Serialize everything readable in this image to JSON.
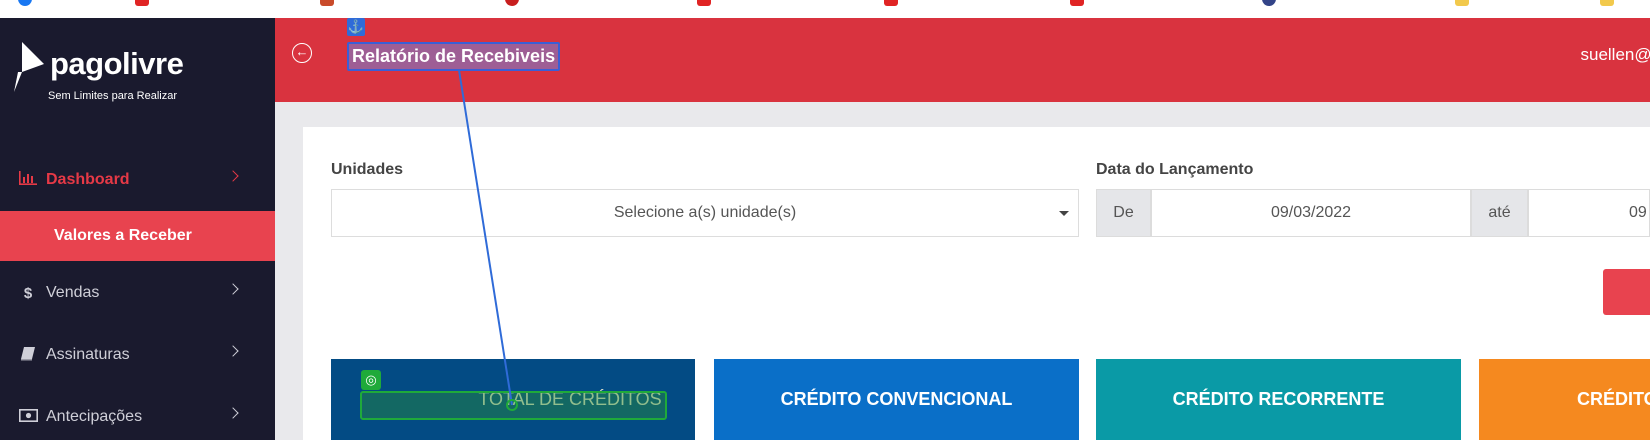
{
  "brand": {
    "name": "pagolivre",
    "tagline": "Sem Limites para Realizar"
  },
  "sidebar": {
    "items": [
      {
        "label": "Dashboard",
        "icon": "bar-chart-icon",
        "active": true
      },
      {
        "label": "Vendas",
        "icon": "dollar-icon",
        "active": false
      },
      {
        "label": "Assinaturas",
        "icon": "book-icon",
        "active": false
      },
      {
        "label": "Antecipações",
        "icon": "money-bill-icon",
        "active": false
      }
    ],
    "subitem": "Valores a Receber"
  },
  "header": {
    "title": "Relatório de Recebiveis",
    "user": "suellen@bod"
  },
  "filters": {
    "units_label": "Unidades",
    "units_placeholder": "Selecione a(s) unidade(s)",
    "date_label": "Data do Lançamento",
    "from_label": "De",
    "from_value": "09/03/2022",
    "to_label": "até",
    "to_value": "09"
  },
  "tiles": [
    {
      "label": "TOTAL DE CRÉDITOS",
      "color": "#034b84"
    },
    {
      "label": "CRÉDITO CONVENCIONAL",
      "color": "#0a6fc8"
    },
    {
      "label": "CRÉDITO RECORRENTE",
      "color": "#0a9aa6"
    },
    {
      "label": "CRÉDITO",
      "color": "#f5891f"
    }
  ],
  "colors": {
    "sidebar": "#1a1a2e",
    "header": "#d9333f",
    "accent": "#e8434f"
  }
}
